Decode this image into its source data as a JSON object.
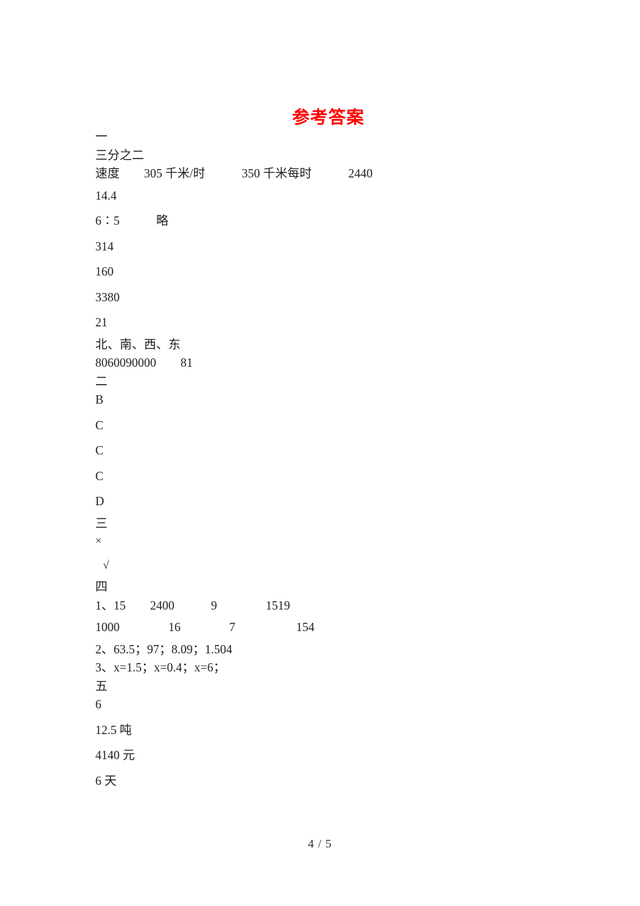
{
  "document": {
    "title": "参考答案",
    "title_color": "#ff0000",
    "background_color": "#ffffff",
    "text_color": "#1f1f1f"
  },
  "sections": [
    {
      "marker": "一",
      "lines": [
        "三分之二",
        "速度　　305 千米/时　　　350 千米每时　　　2440",
        "14.4",
        "6∶5　　　略",
        "314",
        "160",
        "3380",
        "21",
        "北、南、西、东",
        "8060090000　　81"
      ]
    },
    {
      "marker": "二",
      "lines": [
        "B",
        "C",
        "C",
        "C",
        "D"
      ]
    },
    {
      "marker": "三",
      "lines": [
        "×",
        "√"
      ]
    },
    {
      "marker": "四",
      "lines": [
        "1、15　　2400　　　9　　　　1519",
        "1000　　　　16　　　　7　　　　　154",
        "2、63.5；97；8.09；1.504",
        "3、x=1.5；x=0.4；x=6；"
      ]
    },
    {
      "marker": "五",
      "lines": [
        "6",
        "12.5 吨",
        "4140 元",
        "6 天"
      ]
    }
  ],
  "footer": {
    "current_page": "4",
    "separator": "/",
    "total_pages": "5"
  }
}
